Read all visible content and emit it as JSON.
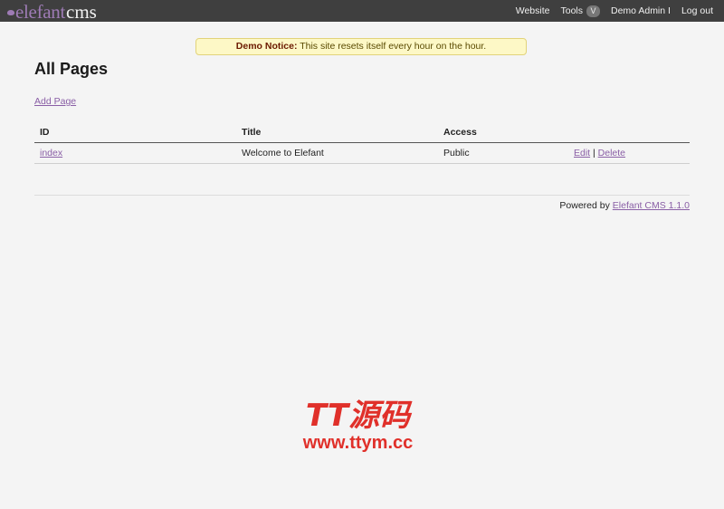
{
  "brand": {
    "part1": "elefant",
    "part2": "cms"
  },
  "nav": {
    "website": "Website",
    "tools": "Tools",
    "tools_chevron": "V",
    "user": "Demo Admin I",
    "logout": "Log out"
  },
  "notice": {
    "label": "Demo Notice:",
    "text": "This site resets itself every hour on the hour."
  },
  "page": {
    "title": "All Pages",
    "add_link": "Add Page"
  },
  "table": {
    "headers": [
      "ID",
      "Title",
      "Access",
      ""
    ],
    "rows": [
      {
        "id": "index",
        "title": "Welcome to Elefant",
        "access": "Public",
        "edit": "Edit",
        "sep": "|",
        "delete": "Delete"
      }
    ]
  },
  "footer": {
    "prefix": "Powered by",
    "link": "Elefant CMS 1.1.0"
  },
  "watermark": {
    "line1": "TT源码",
    "line2": "www.ttym.cc"
  },
  "colors": {
    "topbar": "#3f3f3f",
    "accent": "#9e7bb5",
    "link": "#8a5fa6",
    "notice_bg": "#fdf8c6",
    "watermark": "#e0302a"
  }
}
